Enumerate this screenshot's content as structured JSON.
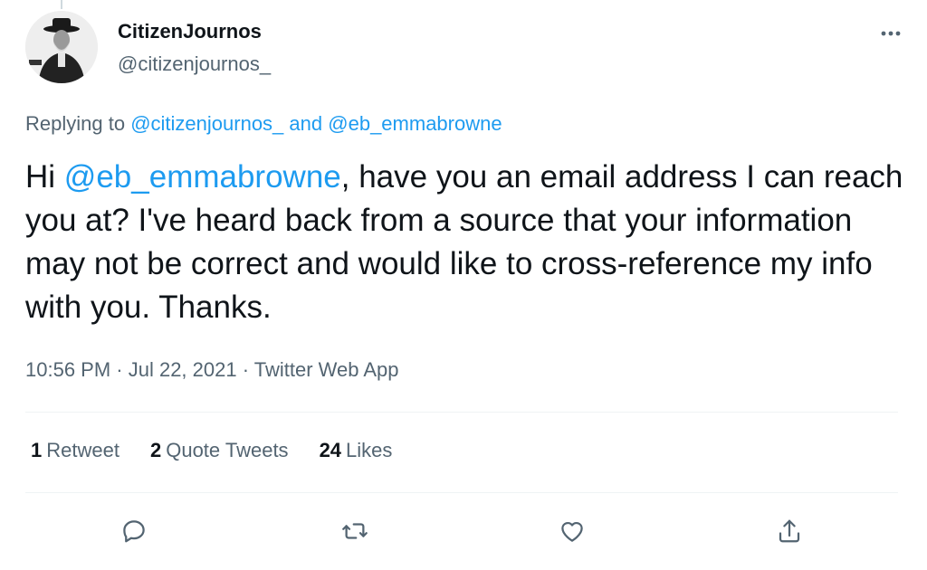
{
  "author": {
    "name": "CitizenJournos",
    "handle": "@citizenjournos_"
  },
  "replying": {
    "prefix": "Replying to",
    "mention1": "@citizenjournos_",
    "conjunction": "and",
    "mention2": "@eb_emmabrowne"
  },
  "tweet": {
    "greeting": "Hi",
    "mention": "@eb_emmabrowne",
    "body": ", have you an email address I can reach you at? I've heard back from a source that your information may not be correct and would like to cross-reference my info with you. Thanks.",
    "meta": "10:56 PM · Jul 22, 2021 · Twitter Web App"
  },
  "stats": {
    "retweets": {
      "count": "1",
      "label": "Retweet"
    },
    "quotes": {
      "count": "2",
      "label": "Quote Tweets"
    },
    "likes": {
      "count": "24",
      "label": "Likes"
    }
  },
  "icons": {
    "more": "more-icon",
    "reply": "reply-icon",
    "retweet": "retweet-icon",
    "like": "like-icon",
    "share": "share-icon"
  },
  "colors": {
    "accent": "#1d9bf0",
    "secondary_text": "#536471",
    "primary_text": "#0f1419",
    "divider": "#eff3f4"
  }
}
